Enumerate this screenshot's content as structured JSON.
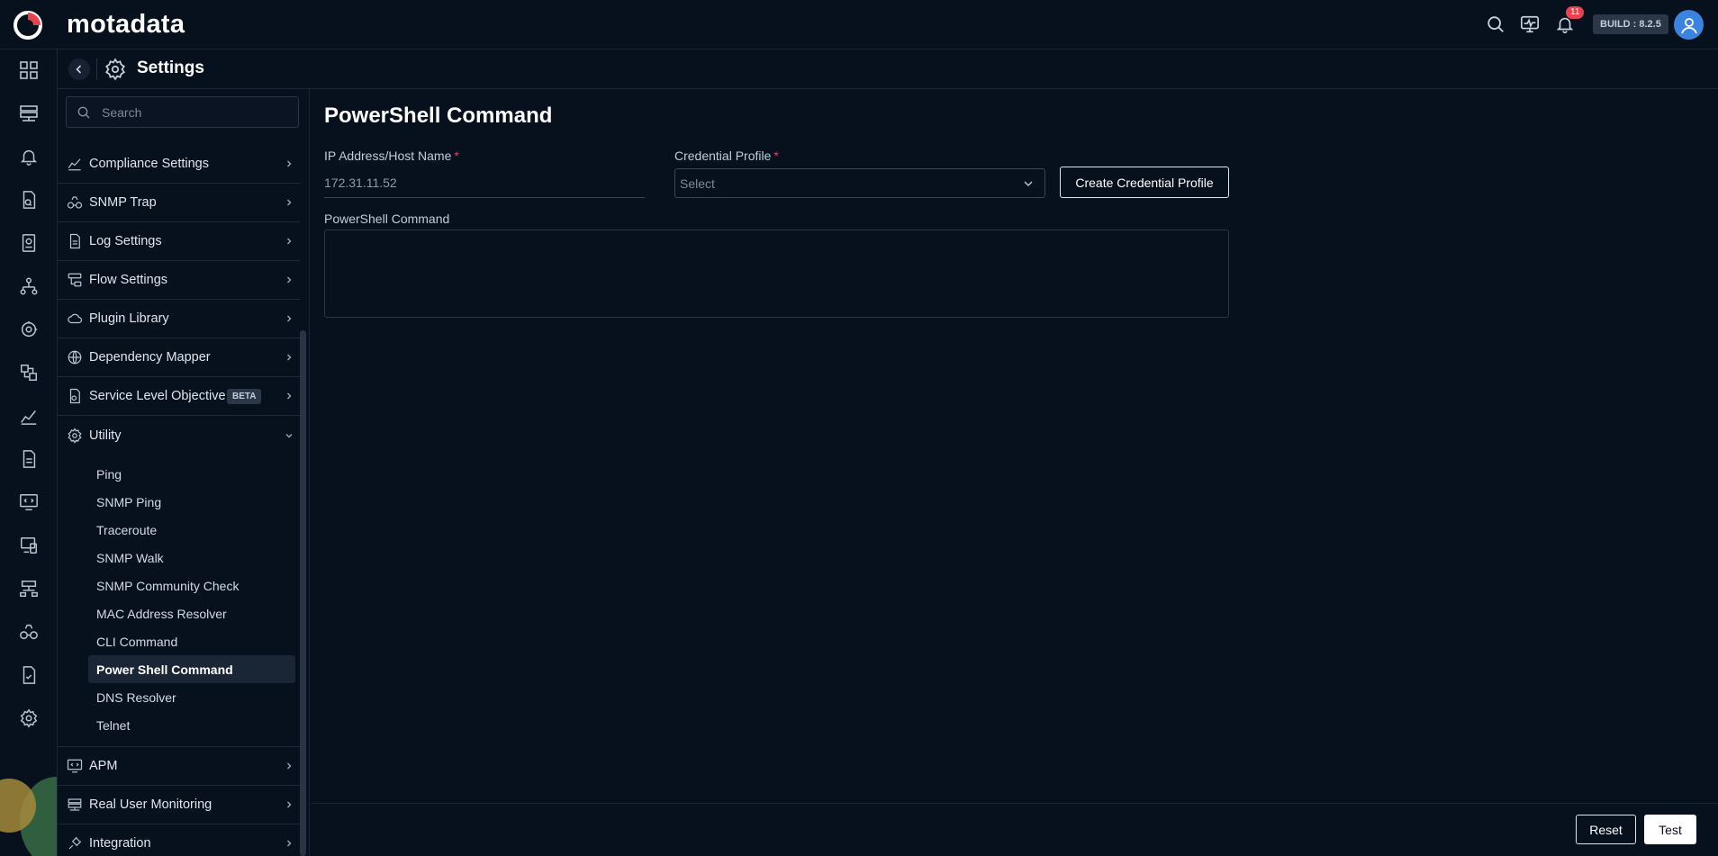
{
  "app": {
    "logo_text": "motadata",
    "build_label": "BUILD : 8.2.5",
    "notification_count": "11"
  },
  "header": {
    "title": "Settings"
  },
  "sidebar": {
    "search_placeholder": "Search",
    "items": [
      {
        "label": "Compliance Settings",
        "icon": "compliance-icon"
      },
      {
        "label": "SNMP Trap",
        "icon": "binoculars-icon"
      },
      {
        "label": "Log Settings",
        "icon": "document-icon"
      },
      {
        "label": "Flow Settings",
        "icon": "flow-icon"
      },
      {
        "label": "Plugin Library",
        "icon": "cloud-icon"
      },
      {
        "label": "Dependency Mapper",
        "icon": "globe-icon"
      },
      {
        "label": "Service Level Objective",
        "icon": "slo-icon",
        "badge": "BETA"
      },
      {
        "label": "Utility",
        "icon": "utility-gear-icon",
        "expanded": true
      }
    ],
    "utility_items": [
      {
        "label": "Ping"
      },
      {
        "label": "SNMP Ping"
      },
      {
        "label": "Traceroute"
      },
      {
        "label": "SNMP Walk"
      },
      {
        "label": "SNMP Community Check"
      },
      {
        "label": "MAC Address Resolver"
      },
      {
        "label": "CLI Command"
      },
      {
        "label": "Power Shell Command",
        "active": true
      },
      {
        "label": "DNS Resolver"
      },
      {
        "label": "Telnet"
      }
    ],
    "bottom_items": [
      {
        "label": "APM",
        "icon": "monitor-code-icon"
      },
      {
        "label": "Real User Monitoring",
        "icon": "server-icon"
      },
      {
        "label": "Integration",
        "icon": "plug-icon"
      }
    ]
  },
  "main": {
    "title": "PowerShell Command",
    "ip_label": "IP Address/Host Name",
    "ip_value": "172.31.11.52",
    "credential_label": "Credential Profile",
    "credential_placeholder": "Select",
    "create_credential_label": "Create Credential Profile",
    "powershell_label": "PowerShell Command",
    "powershell_value": "",
    "required_mark": "*",
    "reset_label": "Reset",
    "test_label": "Test"
  },
  "colors": {
    "background": "#07101d",
    "accent": "#3b83e0",
    "required": "#e8434c",
    "logo_red": "#e8434c"
  }
}
